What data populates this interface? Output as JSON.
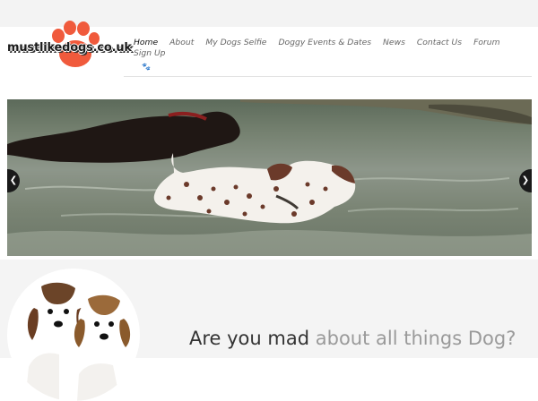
{
  "site": {
    "logo_text": "mustlikedogs.co.uk",
    "brand_color": "#f05a3c"
  },
  "nav": {
    "items": [
      {
        "label": "Home",
        "active": true
      },
      {
        "label": "About"
      },
      {
        "label": "My Dogs Selfie"
      },
      {
        "label": "Doggy Events & Dates"
      },
      {
        "label": "News"
      },
      {
        "label": "Contact Us"
      },
      {
        "label": "Forum"
      }
    ],
    "signup_label": "Sign Up",
    "paw_icon": "paw-icon"
  },
  "slider": {
    "prev_icon": "chevron-left-icon",
    "next_icon": "chevron-right-icon"
  },
  "hero": {
    "tagline_dark": "Are you mad",
    "tagline_light": "about all things Dog?"
  }
}
